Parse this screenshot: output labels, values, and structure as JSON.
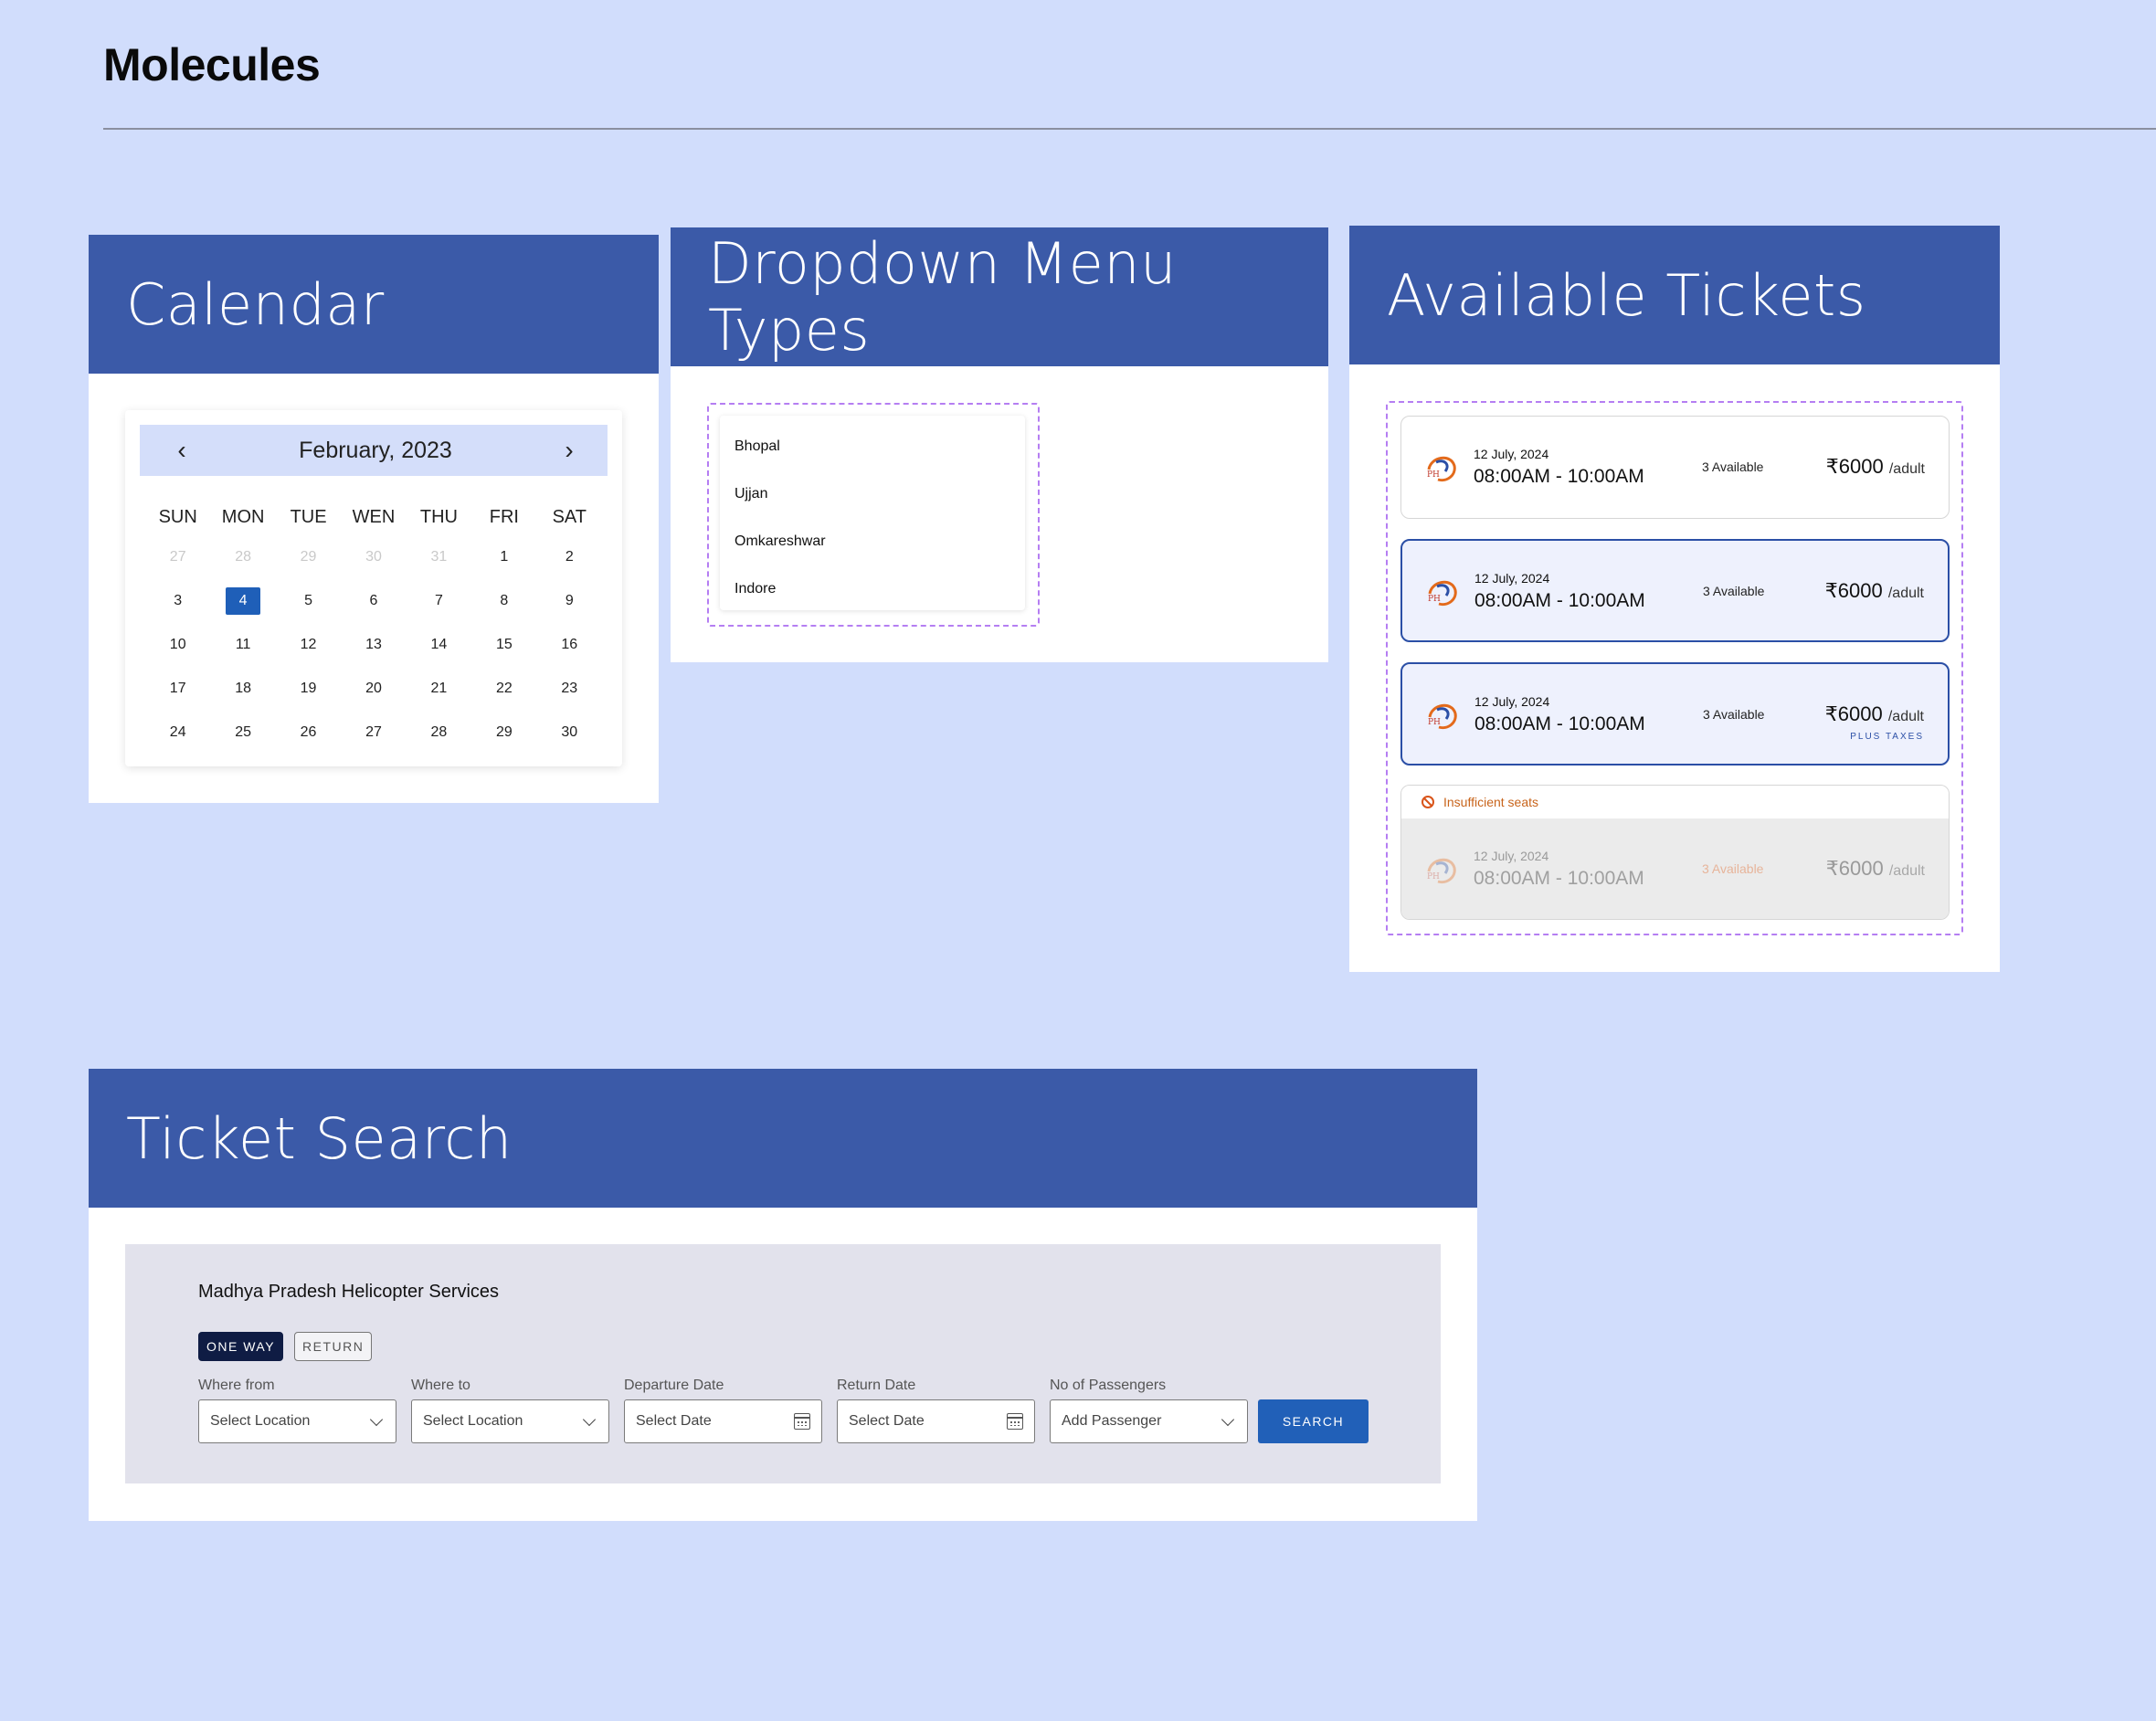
{
  "page": {
    "title": "Molecules"
  },
  "calendar": {
    "heading": "Calendar",
    "month_label": "February, 2023",
    "prev_arrow": "‹",
    "next_arrow": "›",
    "weekdays": [
      "SUN",
      "MON",
      "TUE",
      "WEN",
      "THU",
      "FRI",
      "SAT"
    ],
    "weeks": [
      [
        "27",
        "28",
        "29",
        "30",
        "31",
        "1",
        "2"
      ],
      [
        "3",
        "4",
        "5",
        "6",
        "7",
        "8",
        "9"
      ],
      [
        "10",
        "11",
        "12",
        "13",
        "14",
        "15",
        "16"
      ],
      [
        "17",
        "18",
        "19",
        "20",
        "21",
        "22",
        "23"
      ],
      [
        "24",
        "25",
        "26",
        "27",
        "28",
        "29",
        "30"
      ]
    ],
    "muted_days_in_first_week": 5,
    "selected_day": "4"
  },
  "dropdown": {
    "heading": "Dropdown Menu Types",
    "items": [
      "Bhopal",
      "Ujjan",
      "Omkareshwar",
      "Indore"
    ]
  },
  "tickets": {
    "heading": "Available Tickets",
    "cards": [
      {
        "date": "12 July, 2024",
        "time": "08:00AM - 10:00AM",
        "availability": "3 Available",
        "price": "₹6000",
        "unit": "/adult",
        "state": "default"
      },
      {
        "date": "12 July, 2024",
        "time": "08:00AM - 10:00AM",
        "availability": "3 Available",
        "price": "₹6000",
        "unit": "/adult",
        "state": "selected"
      },
      {
        "date": "12 July, 2024",
        "time": "08:00AM - 10:00AM",
        "availability": "3 Available",
        "price": "₹6000",
        "unit": "/adult",
        "state": "selected",
        "note": "PLUS TAXES"
      }
    ],
    "disabled_card": {
      "warning": "Insufficient seats",
      "date": "12 July, 2024",
      "time": "08:00AM - 10:00AM",
      "availability": "3 Available",
      "price": "₹6000",
      "unit": "/adult"
    }
  },
  "ticket_search": {
    "heading": "Ticket Search",
    "title": "Madhya Pradesh Helicopter Services",
    "one_way_label": "ONE WAY",
    "return_label": "RETURN",
    "fields": [
      {
        "label": "Where from",
        "placeholder": "Select Location",
        "icon": "chevron-down-icon"
      },
      {
        "label": "Where to",
        "placeholder": "Select Location",
        "icon": "chevron-down-icon"
      },
      {
        "label": "Departure Date",
        "placeholder": "Select Date",
        "icon": "calendar-icon"
      },
      {
        "label": "Return Date",
        "placeholder": "Select Date",
        "icon": "calendar-icon"
      },
      {
        "label": "No of Passengers",
        "placeholder": "Add Passenger",
        "icon": "chevron-down-icon"
      }
    ],
    "search_label": "SEARCH"
  },
  "colors": {
    "page_background": "#d1ddfc",
    "panel_header": "#3b5aa8",
    "accent_blue": "#2160b8",
    "selected_card_border": "#2b4fa6",
    "dashed_outline": "#b57ef2",
    "warning_orange": "#c8641b"
  }
}
